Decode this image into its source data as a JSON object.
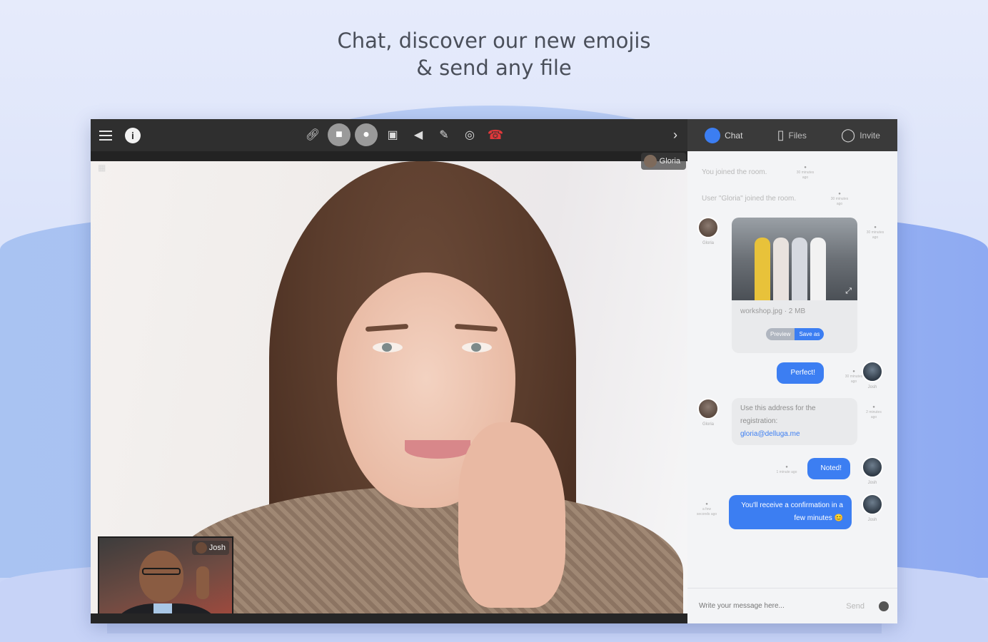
{
  "headline": {
    "line1": "Chat, discover our new emojis",
    "line2": "& send any file"
  },
  "toolbar": {
    "left_icons": [
      "menu-icon",
      "info-icon"
    ],
    "center_icons": [
      "link-icon",
      "camera-icon",
      "microphone-icon",
      "screen-share-icon",
      "megaphone-icon",
      "draw-icon",
      "record-icon",
      "hang-up-icon"
    ],
    "right_icon": "chevron-right-icon",
    "hang_up_color": "#e0383a"
  },
  "video": {
    "main_participant": "Gloria",
    "pip_participant": "Josh"
  },
  "panel": {
    "tabs": [
      {
        "label": "Chat",
        "icon": "chat-icon"
      },
      {
        "label": "Files",
        "icon": "file-icon"
      },
      {
        "label": "Invite",
        "icon": "user-icon"
      }
    ],
    "accent": "#3c7ef2"
  },
  "chat": {
    "system_messages": [
      {
        "text": "You joined the room.",
        "time": "30 minutes ago"
      },
      {
        "text": "User \"Gloria\" joined the room.",
        "time": "30 minutes ago"
      }
    ],
    "file_message": {
      "author": "Gloria",
      "time": "30 minutes ago",
      "file_name": "workshop.jpg · 2 MB",
      "preview_label": "Preview",
      "save_label": "Save as"
    },
    "messages": [
      {
        "author": "Josh",
        "text": "Perfect!",
        "time": "30 minutes ago",
        "outgoing": true
      },
      {
        "author": "Gloria",
        "text": "Use this address for the registration:",
        "link": "gloria@delluga.me",
        "time": "2 minutes ago",
        "outgoing": false
      },
      {
        "author": "Josh",
        "text": "Noted!",
        "time": "1 minute ago",
        "outgoing": true
      },
      {
        "author": "Josh",
        "text": "You'll receive a confirmation in a few minutes 😊",
        "time": "a few seconds ago",
        "outgoing": true
      }
    ]
  },
  "composer": {
    "placeholder": "Write your message here...",
    "send_label": "Send",
    "emoji_icon": "emoji-icon"
  }
}
